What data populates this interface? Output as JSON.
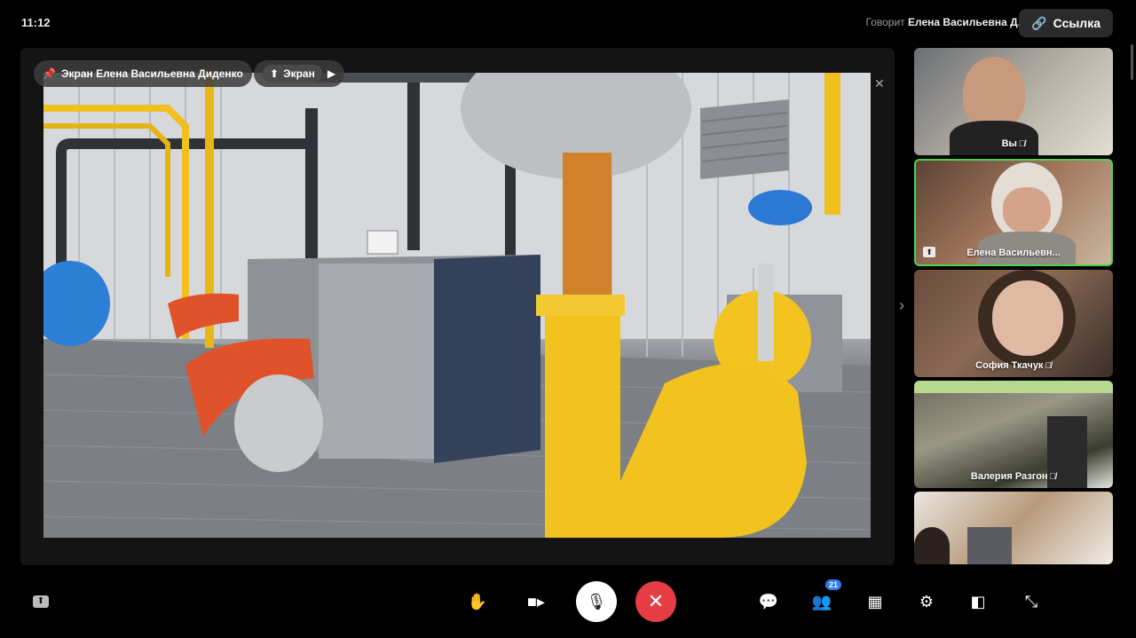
{
  "status": {
    "time": "11:12",
    "speaker_prefix": "Говорит",
    "speaker_name": "Елена Васильевна Д."
  },
  "header": {
    "link_label": "Ссылка"
  },
  "stage": {
    "presenter_pill": "Экран Елена Васильевна Диденко",
    "screen_pill": "Экран"
  },
  "participants": [
    {
      "name": "Вы",
      "muted": true
    },
    {
      "name": "Елена Васильевн...",
      "muted": false,
      "active": true
    },
    {
      "name": "София Ткачук",
      "muted": true
    },
    {
      "name": "Валерия Разгон",
      "muted": true
    },
    {
      "name": "",
      "muted": false
    }
  ],
  "toolbar": {
    "participants_count": "21"
  },
  "colors": {
    "end_call": "#e63d45",
    "active_border": "#4fd34f",
    "badge": "#2f7cf6"
  }
}
